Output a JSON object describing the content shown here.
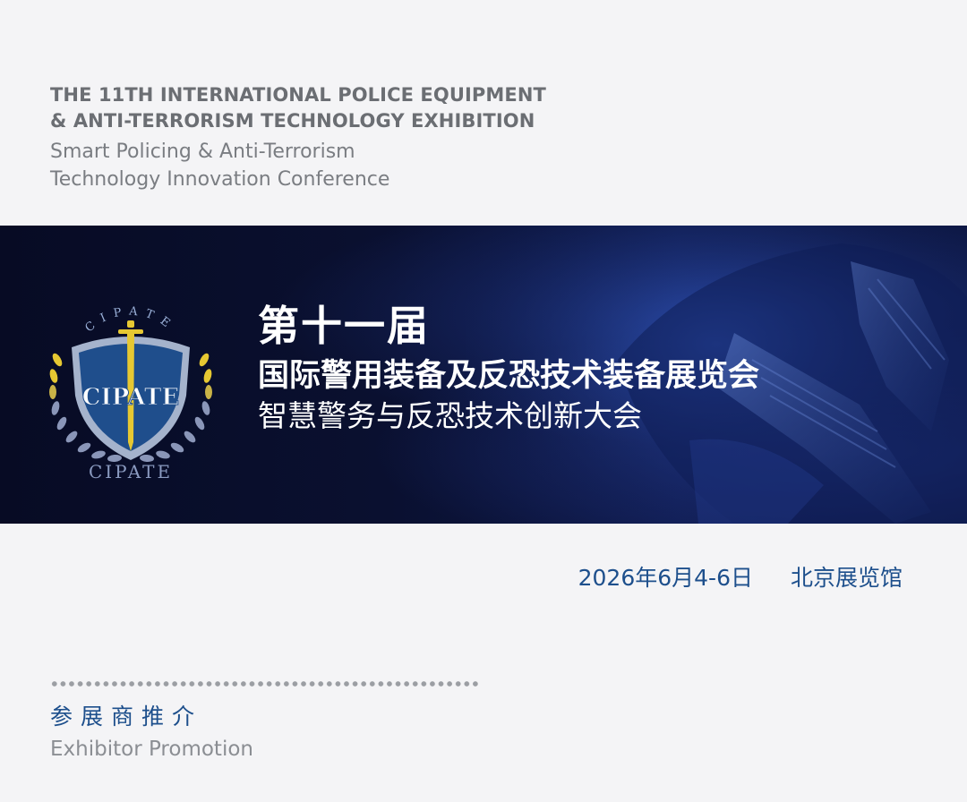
{
  "header": {
    "en_title_line1": "THE 11TH INTERNATIONAL POLICE EQUIPMENT",
    "en_title_line2": "& ANTI-TERRORISM TECHNOLOGY EXHIBITION",
    "en_subtitle_line1": "Smart Policing & Anti-Terrorism",
    "en_subtitle_line2": "Technology Innovation Conference"
  },
  "banner": {
    "edition": "第十一届",
    "exhibition_name": "国际警用装备及反恐技术装备展览会",
    "conference_name": "智慧警务与反恐技术创新大会",
    "emblem": {
      "arc_text": "CIPATE",
      "shield_text": "CIPATE",
      "bottom_text": "CIPATE"
    }
  },
  "event": {
    "date": "2026年6月4-6日",
    "venue": "北京展览馆"
  },
  "section": {
    "title_cn": "参展商推介",
    "title_en": "Exhibitor Promotion"
  },
  "colors": {
    "background": "#f4f4f6",
    "banner_dark": "#0a1030",
    "accent_blue": "#1d4f8c",
    "header_gray": "#6b6e73",
    "emblem_shield": "#1f4e8c",
    "emblem_gold": "#e6c832"
  }
}
